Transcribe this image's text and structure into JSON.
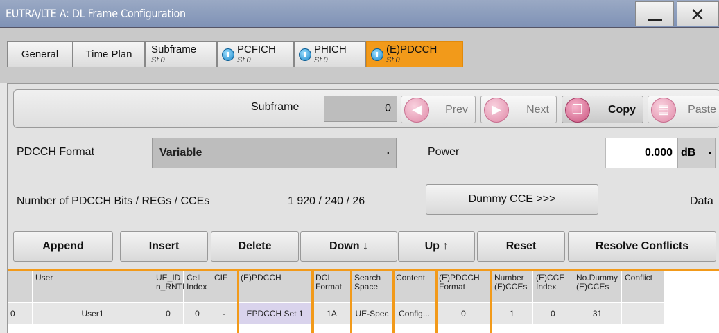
{
  "window": {
    "title": "EUTRA/LTE A: DL Frame Configuration",
    "min_glyph": "—",
    "close_glyph": "✕"
  },
  "tabs": [
    {
      "label": "General"
    },
    {
      "label": "Time Plan"
    },
    {
      "label": "Subframe",
      "sub": "Sf 0"
    },
    {
      "label": "PCFICH",
      "sub": "Sf 0",
      "icon": "info-icon"
    },
    {
      "label": "PHICH",
      "sub": "Sf 0",
      "icon": "info-icon"
    },
    {
      "label": "(E)PDCCH",
      "sub": "Sf 0",
      "icon": "info-icon",
      "active": true
    }
  ],
  "subframe": {
    "label": "Subframe",
    "value": "0",
    "prev": "Prev",
    "next": "Next",
    "copy": "Copy",
    "paste": "Paste"
  },
  "pdcch": {
    "format_label": "PDCCH Format",
    "format_value": "Variable",
    "power_label": "Power",
    "power_value": "0.000",
    "power_unit": "dB",
    "bits_label": "Number of PDCCH Bits / REGs / CCEs",
    "bits_value": "1 920 / 240 / 26",
    "dummy_cce": "Dummy CCE >>>",
    "data_label": "Data"
  },
  "actions": {
    "append": "Append",
    "insert": "Insert",
    "delete": "Delete",
    "down": "Down ↓",
    "up": "Up ↑",
    "reset": "Reset",
    "resolve": "Resolve Conflicts"
  },
  "table": {
    "headers": [
      "",
      "User",
      "UE_ID n_RNTI",
      "Cell Index",
      "CIF",
      "(E)PDCCH",
      "DCI Format",
      "Search Space",
      "Content",
      "(E)PDCCH Format",
      "Number (E)CCEs",
      "(E)CCE Index",
      "No.Dummy (E)CCEs",
      "Conflict"
    ],
    "rows": [
      [
        "0",
        "User1",
        "0",
        "0",
        "-",
        "EPDCCH Set 1",
        "1A",
        "UE-Spec",
        "Config...",
        "0",
        "1",
        "0",
        "31",
        ""
      ]
    ]
  },
  "colors": {
    "accent": "#f29a1a",
    "titlebar": "#8a9bbd"
  }
}
